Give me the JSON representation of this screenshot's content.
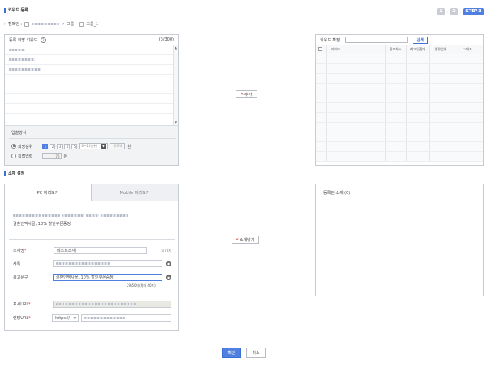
{
  "header": {
    "title": "키워드 등록",
    "steps": [
      "1",
      "2",
      "STEP 3"
    ],
    "campaign_label": "캠페인 :",
    "group_label": "> 그룹 :",
    "group_value": "그룹_1"
  },
  "left_panel": {
    "title": "등록 희망 키워드",
    "count": "(3/300)"
  },
  "bid_method": {
    "title": "입찰방식",
    "option_rank": "희망순위",
    "ranks": [
      "1",
      "2",
      "3",
      "4",
      "5"
    ],
    "rank_select": "6~10순위",
    "rank_button": "한도액",
    "unit": "원",
    "option_direct": "직접입력",
    "direct_value": "70",
    "direct_unit": "원"
  },
  "add_button": {
    "icon": "«",
    "label": "추가"
  },
  "right_panel": {
    "title": "키워드 확장",
    "search_button": "검색",
    "columns": [
      "키워드",
      "월조회수",
      "최고입찰가",
      "경쟁업체",
      "그래프"
    ]
  },
  "ad_section": {
    "title": "소재 설정"
  },
  "preview_tabs": {
    "pc": "PC 미리보기",
    "mobile": "Mobile 미리보기"
  },
  "preview": {
    "desc": "결혼인맥사몰, 10% 할인쿠폰증정"
  },
  "form": {
    "name_label": "소재명",
    "name_value": "테스트소재",
    "name_count": "5/70자",
    "title_label": "제목",
    "desc_label": "광고문구",
    "desc_value": "결혼인맥사몰, 10% 할인쿠폰증정",
    "desc_count": "29/50자(최대 40자)",
    "display_url_label": "표시URL",
    "link_url_label": "랜딩URL",
    "protocol": "https://"
  },
  "copy_button": {
    "icon": "«",
    "label": "소재넣기"
  },
  "registered_panel": {
    "title": "등록된 소재 (0)"
  },
  "footer": {
    "confirm": "확인",
    "cancel": "취소"
  }
}
